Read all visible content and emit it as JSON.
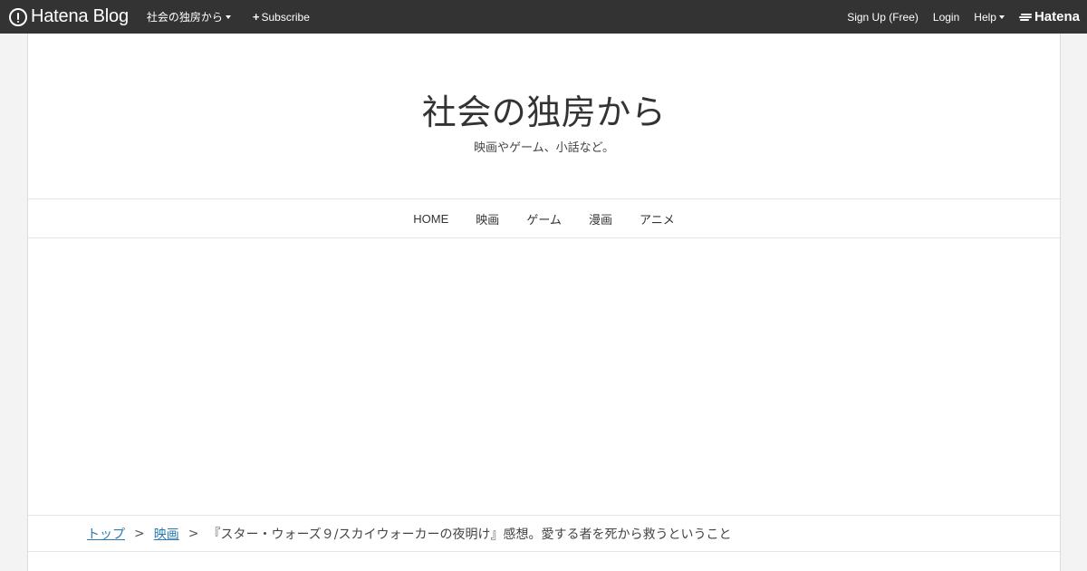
{
  "topbar": {
    "brand": "Hatena Blog",
    "blog_menu": "社会の独房から",
    "subscribe": "Subscribe",
    "signup": "Sign Up (Free)",
    "login": "Login",
    "help": "Help",
    "hatena": "Hatena"
  },
  "header": {
    "title": "社会の独房から",
    "description": "映画やゲーム、小話など。"
  },
  "nav": {
    "items": [
      "HOME",
      "映画",
      "ゲーム",
      "漫画",
      "アニメ"
    ]
  },
  "breadcrumb": {
    "top": "トップ",
    "category": "映画",
    "separator": ">",
    "current": "『スター・ウォーズ９/スカイウォーカーの夜明け』感想。愛する者を死から救うということ"
  }
}
